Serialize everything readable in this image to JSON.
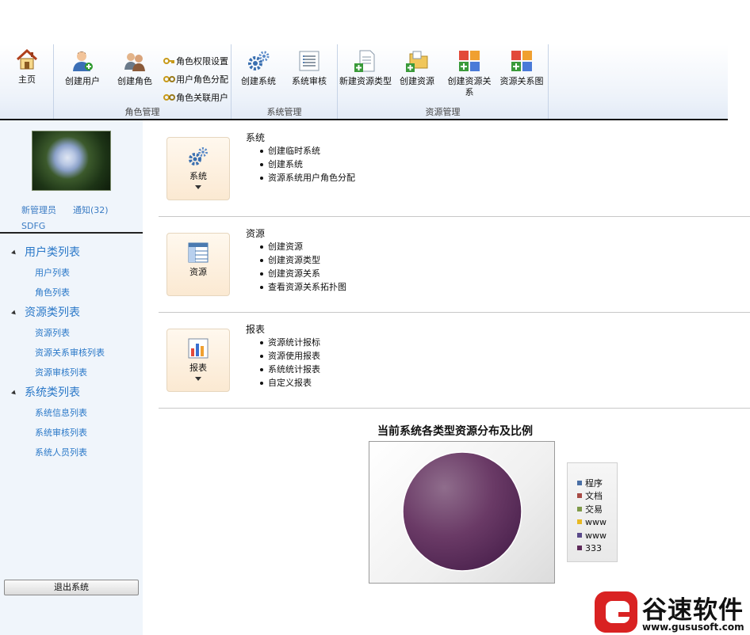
{
  "ribbon": {
    "home": "主页",
    "role_group": {
      "label": "角色管理",
      "create_user": "创建用户",
      "create_role": "创建角色",
      "role_permission": "角色权限设置",
      "user_role_assign": "用户角色分配",
      "role_linked_users": "角色关联用户"
    },
    "system_group": {
      "label": "系统管理",
      "create_system": "创建系统",
      "system_review": "系统审核"
    },
    "resource_group": {
      "label": "资源管理",
      "new_resource_type": "新建资源类型",
      "create_resource": "创建资源",
      "create_resource_relation": "创建资源关系",
      "resource_relation_graph": "资源关系图"
    }
  },
  "sidebar": {
    "new_admin": "新管理员",
    "notifications": "通知(32)",
    "username": "SDFG",
    "sections": [
      {
        "title": "用户类列表",
        "items": [
          "用户列表",
          "角色列表"
        ]
      },
      {
        "title": "资源类列表",
        "items": [
          "资源列表",
          "资源关系审核列表",
          "资源审核列表"
        ]
      },
      {
        "title": "系统类列表",
        "items": [
          "系统信息列表",
          "系统审核列表",
          "系统人员列表"
        ]
      }
    ],
    "logout": "退出系统"
  },
  "main": {
    "sections": [
      {
        "tile_label": "系统",
        "title": "系统",
        "items": [
          "创建临时系统",
          "创建系统",
          "资源系统用户角色分配"
        ]
      },
      {
        "tile_label": "资源",
        "title": "资源",
        "items": [
          "创建资源",
          "创建资源类型",
          "创建资源关系",
          "查看资源关系拓扑图"
        ]
      },
      {
        "tile_label": "报表",
        "title": "报表",
        "items": [
          "资源统计报标",
          "资源使用报表",
          "系统统计报表",
          "自定义报表"
        ]
      }
    ]
  },
  "chart_data": {
    "type": "pie",
    "title": "当前系统各类型资源分布及比例",
    "categories": [
      "程序",
      "文档",
      "交易",
      "www",
      "www",
      "333"
    ],
    "values": [
      0,
      0,
      0,
      0,
      0,
      100
    ],
    "colors": [
      "#4a6fa5",
      "#a84b46",
      "#7f9a4a",
      "#e8b923",
      "#5a4a8a",
      "#5e2a5a"
    ],
    "legend_position": "right"
  },
  "watermark": {
    "brand": "谷速软件",
    "url": "www.gususoft.com"
  }
}
